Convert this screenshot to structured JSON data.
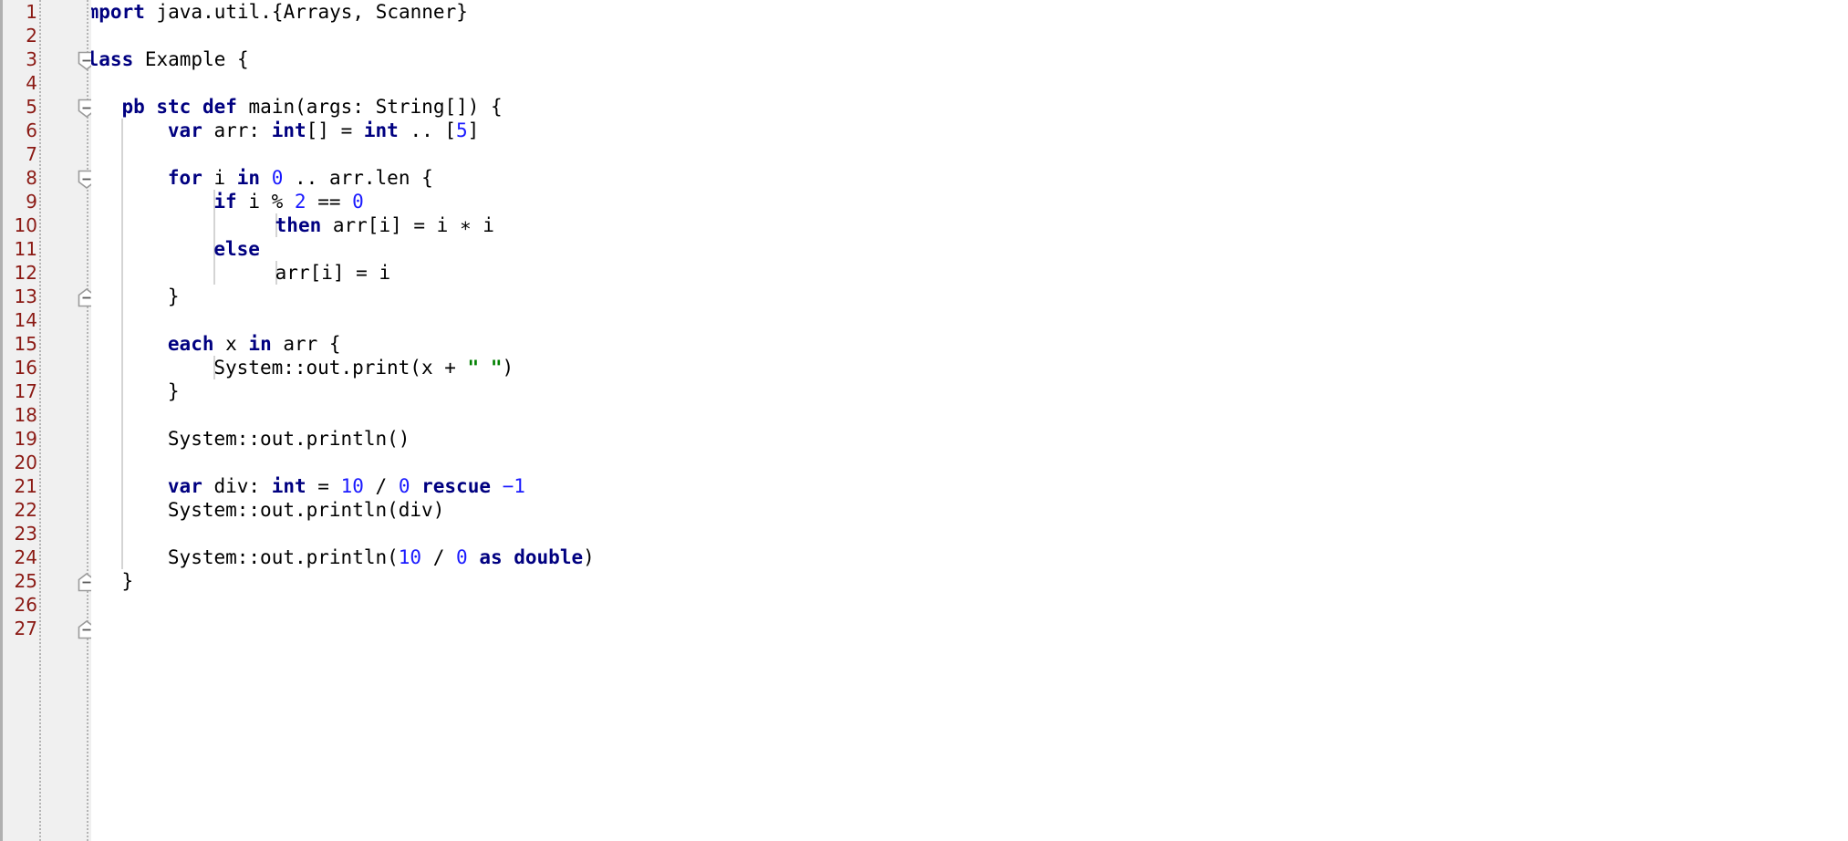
{
  "editor": {
    "language": "scala-like",
    "total_lines": 27,
    "colors": {
      "background": "#ffffff",
      "gutter_background": "#f0f0f0",
      "line_number": "#8b1a14",
      "keyword": "#000080",
      "number": "#1a1aff",
      "string": "#008000",
      "plain_text": "#000000",
      "indent_guide": "#d4d4d4",
      "fold_marker": "#9a9a9a"
    }
  },
  "gutter": {
    "line_numbers": [
      "1",
      "2",
      "3",
      "4",
      "5",
      "6",
      "7",
      "8",
      "9",
      "10",
      "11",
      "12",
      "13",
      "14",
      "15",
      "16",
      "17",
      "18",
      "19",
      "20",
      "21",
      "22",
      "23",
      "24",
      "25",
      "26",
      "27"
    ],
    "fold_markers": [
      {
        "line": 3,
        "type": "fold-start",
        "label": "collapse-block-line-3"
      },
      {
        "line": 5,
        "type": "fold-start",
        "label": "collapse-block-line-5"
      },
      {
        "line": 8,
        "type": "fold-start",
        "label": "collapse-block-line-8"
      },
      {
        "line": 13,
        "type": "fold-end",
        "label": "collapse-block-line-13"
      },
      {
        "line": 25,
        "type": "fold-end",
        "label": "collapse-block-line-25"
      },
      {
        "line": 27,
        "type": "fold-end",
        "label": "collapse-block-line-27"
      }
    ]
  },
  "indent_guides": [
    {
      "indent_col": 3,
      "from_line": 6,
      "to_line": 24
    },
    {
      "indent_col": 9,
      "from_line": 9,
      "to_line": 12
    },
    {
      "indent_col": 9,
      "from_line": 16,
      "to_line": 16
    },
    {
      "indent_col": 13,
      "from_line": 10,
      "to_line": 10
    },
    {
      "indent_col": 13,
      "from_line": 12,
      "to_line": 12
    }
  ],
  "code": {
    "lines": [
      {
        "n": 1,
        "indent": 0,
        "text": "import java.util.{Arrays, Scanner}",
        "tokens": [
          {
            "t": "import",
            "k": "kw"
          },
          {
            "t": " java.util.{Arrays, Scanner}",
            "k": "pl"
          }
        ]
      },
      {
        "n": 2,
        "indent": 0,
        "text": "",
        "tokens": []
      },
      {
        "n": 3,
        "indent": 0,
        "text": "class Example {",
        "tokens": [
          {
            "t": "class",
            "k": "kw"
          },
          {
            "t": " Example {",
            "k": "pl"
          }
        ]
      },
      {
        "n": 4,
        "indent": 0,
        "text": "",
        "tokens": []
      },
      {
        "n": 5,
        "indent": 3,
        "text": "pb stc def main(args: String[]) {",
        "tokens": [
          {
            "t": "pb stc def",
            "k": "kw"
          },
          {
            "t": " main(args: String[]) {",
            "k": "pl"
          }
        ]
      },
      {
        "n": 6,
        "indent": 6,
        "text": "var arr: int[] = int .. [5]",
        "tokens": [
          {
            "t": "var",
            "k": "kw"
          },
          {
            "t": " arr: ",
            "k": "pl"
          },
          {
            "t": "int",
            "k": "kw"
          },
          {
            "t": "[] = ",
            "k": "pl"
          },
          {
            "t": "int",
            "k": "kw"
          },
          {
            "t": " .. [",
            "k": "pl"
          },
          {
            "t": "5",
            "k": "num"
          },
          {
            "t": "]",
            "k": "pl"
          }
        ]
      },
      {
        "n": 7,
        "indent": 0,
        "text": "",
        "tokens": []
      },
      {
        "n": 8,
        "indent": 6,
        "text": "for i in 0 .. arr.len {",
        "tokens": [
          {
            "t": "for",
            "k": "kw"
          },
          {
            "t": " i ",
            "k": "pl"
          },
          {
            "t": "in",
            "k": "kw"
          },
          {
            "t": " ",
            "k": "pl"
          },
          {
            "t": "0",
            "k": "num"
          },
          {
            "t": " .. arr.len {",
            "k": "pl"
          }
        ]
      },
      {
        "n": 9,
        "indent": 9,
        "text": "if i % 2 == 0",
        "tokens": [
          {
            "t": "if",
            "k": "kw"
          },
          {
            "t": " i % ",
            "k": "pl"
          },
          {
            "t": "2",
            "k": "num"
          },
          {
            "t": " == ",
            "k": "pl"
          },
          {
            "t": "0",
            "k": "num"
          }
        ]
      },
      {
        "n": 10,
        "indent": 13,
        "text": "then arr[i] = i * i",
        "tokens": [
          {
            "t": "then",
            "k": "kw"
          },
          {
            "t": " arr[i] = i ∗ i",
            "k": "pl"
          }
        ]
      },
      {
        "n": 11,
        "indent": 9,
        "text": "else",
        "tokens": [
          {
            "t": "else",
            "k": "kw"
          }
        ]
      },
      {
        "n": 12,
        "indent": 13,
        "text": "arr[i] = i",
        "tokens": [
          {
            "t": "arr[i] = i",
            "k": "pl"
          }
        ]
      },
      {
        "n": 13,
        "indent": 6,
        "text": "}",
        "tokens": [
          {
            "t": "}",
            "k": "pl"
          }
        ]
      },
      {
        "n": 14,
        "indent": 0,
        "text": "",
        "tokens": []
      },
      {
        "n": 15,
        "indent": 6,
        "text": "each x in arr {",
        "tokens": [
          {
            "t": "each",
            "k": "kw"
          },
          {
            "t": " x ",
            "k": "pl"
          },
          {
            "t": "in",
            "k": "kw"
          },
          {
            "t": " arr {",
            "k": "pl"
          }
        ]
      },
      {
        "n": 16,
        "indent": 9,
        "text": "System::out.print(x + \" \")",
        "tokens": [
          {
            "t": "System::out.print(x + ",
            "k": "pl"
          },
          {
            "t": "\" \"",
            "k": "str"
          },
          {
            "t": ")",
            "k": "pl"
          }
        ]
      },
      {
        "n": 17,
        "indent": 6,
        "text": "}",
        "tokens": [
          {
            "t": "}",
            "k": "pl"
          }
        ]
      },
      {
        "n": 18,
        "indent": 0,
        "text": "",
        "tokens": []
      },
      {
        "n": 19,
        "indent": 6,
        "text": "System::out.println()",
        "tokens": [
          {
            "t": "System::out.println()",
            "k": "pl"
          }
        ]
      },
      {
        "n": 20,
        "indent": 0,
        "text": "",
        "tokens": []
      },
      {
        "n": 21,
        "indent": 6,
        "text": "var div: int = 10 / 0 rescue -1",
        "tokens": [
          {
            "t": "var",
            "k": "kw"
          },
          {
            "t": " div: ",
            "k": "pl"
          },
          {
            "t": "int",
            "k": "kw"
          },
          {
            "t": " = ",
            "k": "pl"
          },
          {
            "t": "10",
            "k": "num"
          },
          {
            "t": " / ",
            "k": "pl"
          },
          {
            "t": "0",
            "k": "num"
          },
          {
            "t": " ",
            "k": "pl"
          },
          {
            "t": "rescue",
            "k": "kw"
          },
          {
            "t": " ",
            "k": "pl"
          },
          {
            "t": "−1",
            "k": "num"
          }
        ]
      },
      {
        "n": 22,
        "indent": 6,
        "text": "System::out.println(div)",
        "tokens": [
          {
            "t": "System::out.println(div)",
            "k": "pl"
          }
        ]
      },
      {
        "n": 23,
        "indent": 0,
        "text": "",
        "tokens": []
      },
      {
        "n": 24,
        "indent": 6,
        "text": "System::out.println(10 / 0 as double)",
        "tokens": [
          {
            "t": "System::out.println(",
            "k": "pl"
          },
          {
            "t": "10",
            "k": "num"
          },
          {
            "t": " / ",
            "k": "pl"
          },
          {
            "t": "0",
            "k": "num"
          },
          {
            "t": " ",
            "k": "pl"
          },
          {
            "t": "as double",
            "k": "kw"
          },
          {
            "t": ")",
            "k": "pl"
          }
        ]
      },
      {
        "n": 25,
        "indent": 3,
        "text": "}",
        "tokens": [
          {
            "t": "}",
            "k": "pl"
          }
        ]
      },
      {
        "n": 26,
        "indent": 0,
        "text": "",
        "tokens": []
      },
      {
        "n": 27,
        "indent": 0,
        "text": "}",
        "tokens": [
          {
            "t": "}",
            "k": "pl"
          }
        ]
      }
    ]
  }
}
